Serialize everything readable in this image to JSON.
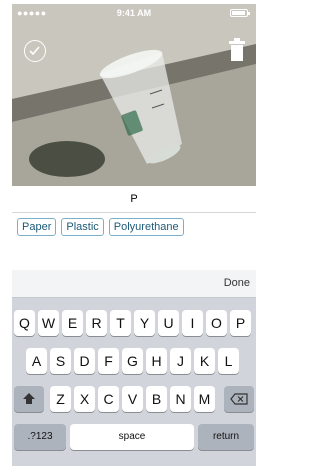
{
  "status": {
    "signal": "●●●●● ",
    "time": "9:41 AM"
  },
  "photo": {
    "check_icon": "check-circle-icon",
    "trash_icon": "trash-icon"
  },
  "tag_input": {
    "value": "P"
  },
  "suggestions": [
    "Paper",
    "Plastic",
    "Polyurethane"
  ],
  "keyboard": {
    "done_label": "Done",
    "row1": [
      "Q",
      "W",
      "E",
      "R",
      "T",
      "Y",
      "U",
      "I",
      "O",
      "P"
    ],
    "row2": [
      "A",
      "S",
      "D",
      "F",
      "G",
      "H",
      "J",
      "K",
      "L"
    ],
    "row3": [
      "Z",
      "X",
      "C",
      "V",
      "B",
      "N",
      "M"
    ],
    "shift_icon": "shift-icon",
    "delete_icon": "delete-icon",
    "numbers_label": ".?123",
    "space_label": "space",
    "return_label": "return"
  }
}
